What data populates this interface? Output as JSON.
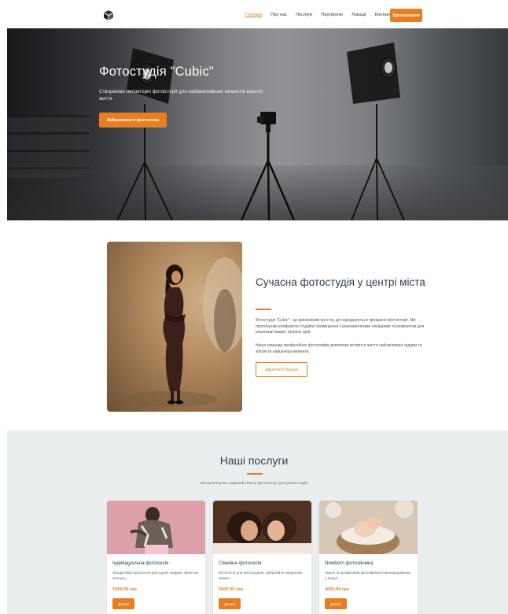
{
  "header": {
    "logo_icon": "cube-logo-icon",
    "nav": [
      {
        "label": "Головна",
        "active": true
      },
      {
        "label": "Про нас",
        "active": false
      },
      {
        "label": "Послуги",
        "active": false
      },
      {
        "label": "Портфоліо",
        "active": false
      },
      {
        "label": "Локації",
        "active": false
      },
      {
        "label": "Контакти",
        "active": false
      }
    ],
    "book_label": "Бронювання"
  },
  "hero": {
    "title": "Фотостудія \"Cubic\"",
    "subtitle": "Створюємо неповторні фотоісторії для найважливіших моментів вашого життя",
    "cta_label": "Забронювати фотосесію"
  },
  "about": {
    "title": "Сучасна фотостудія у центрі міста",
    "p1": "Фотостудія \"Cubic\" - це креативний простір, де народжуються прекрасні фотоісторії. Ми пропонуємо комфортне студійне приміщення з різноманітними локаціями та реквізитом для реалізації ваших творчих ідей.",
    "p2": "Наша команда професійних фотографів допоможе втілити в життя найсміливіші задуми та зберегти найцінніші моменти.",
    "more_label": "Дізнатися більше"
  },
  "services": {
    "title": "Наші послуги",
    "subtitle": "Ми пропонуємо широкий спектр фотопослуг для різних подій",
    "cards": [
      {
        "title": "Індивідуальна фотосесія",
        "desc": "Професійна фотосесія для однієї людини. Включає консуль...",
        "price": "1500.00 грн",
        "btn": "Деталі"
      },
      {
        "title": "Сімейна фотосесія",
        "desc": "Фотосесія для всієї родини. Зберігайте найцінніші момен...",
        "price": "2000.00 грн",
        "btn": "Деталі"
      },
      {
        "title": "Newborn фотозйомка",
        "desc": "Ніжна та професійна фотозйомка новонароджених у перші...",
        "price": "4000.00 грн",
        "btn": "Деталі"
      }
    ]
  },
  "colors": {
    "accent": "#e67e22",
    "heading": "#2c3e50",
    "section_bg": "#ebeeef"
  }
}
